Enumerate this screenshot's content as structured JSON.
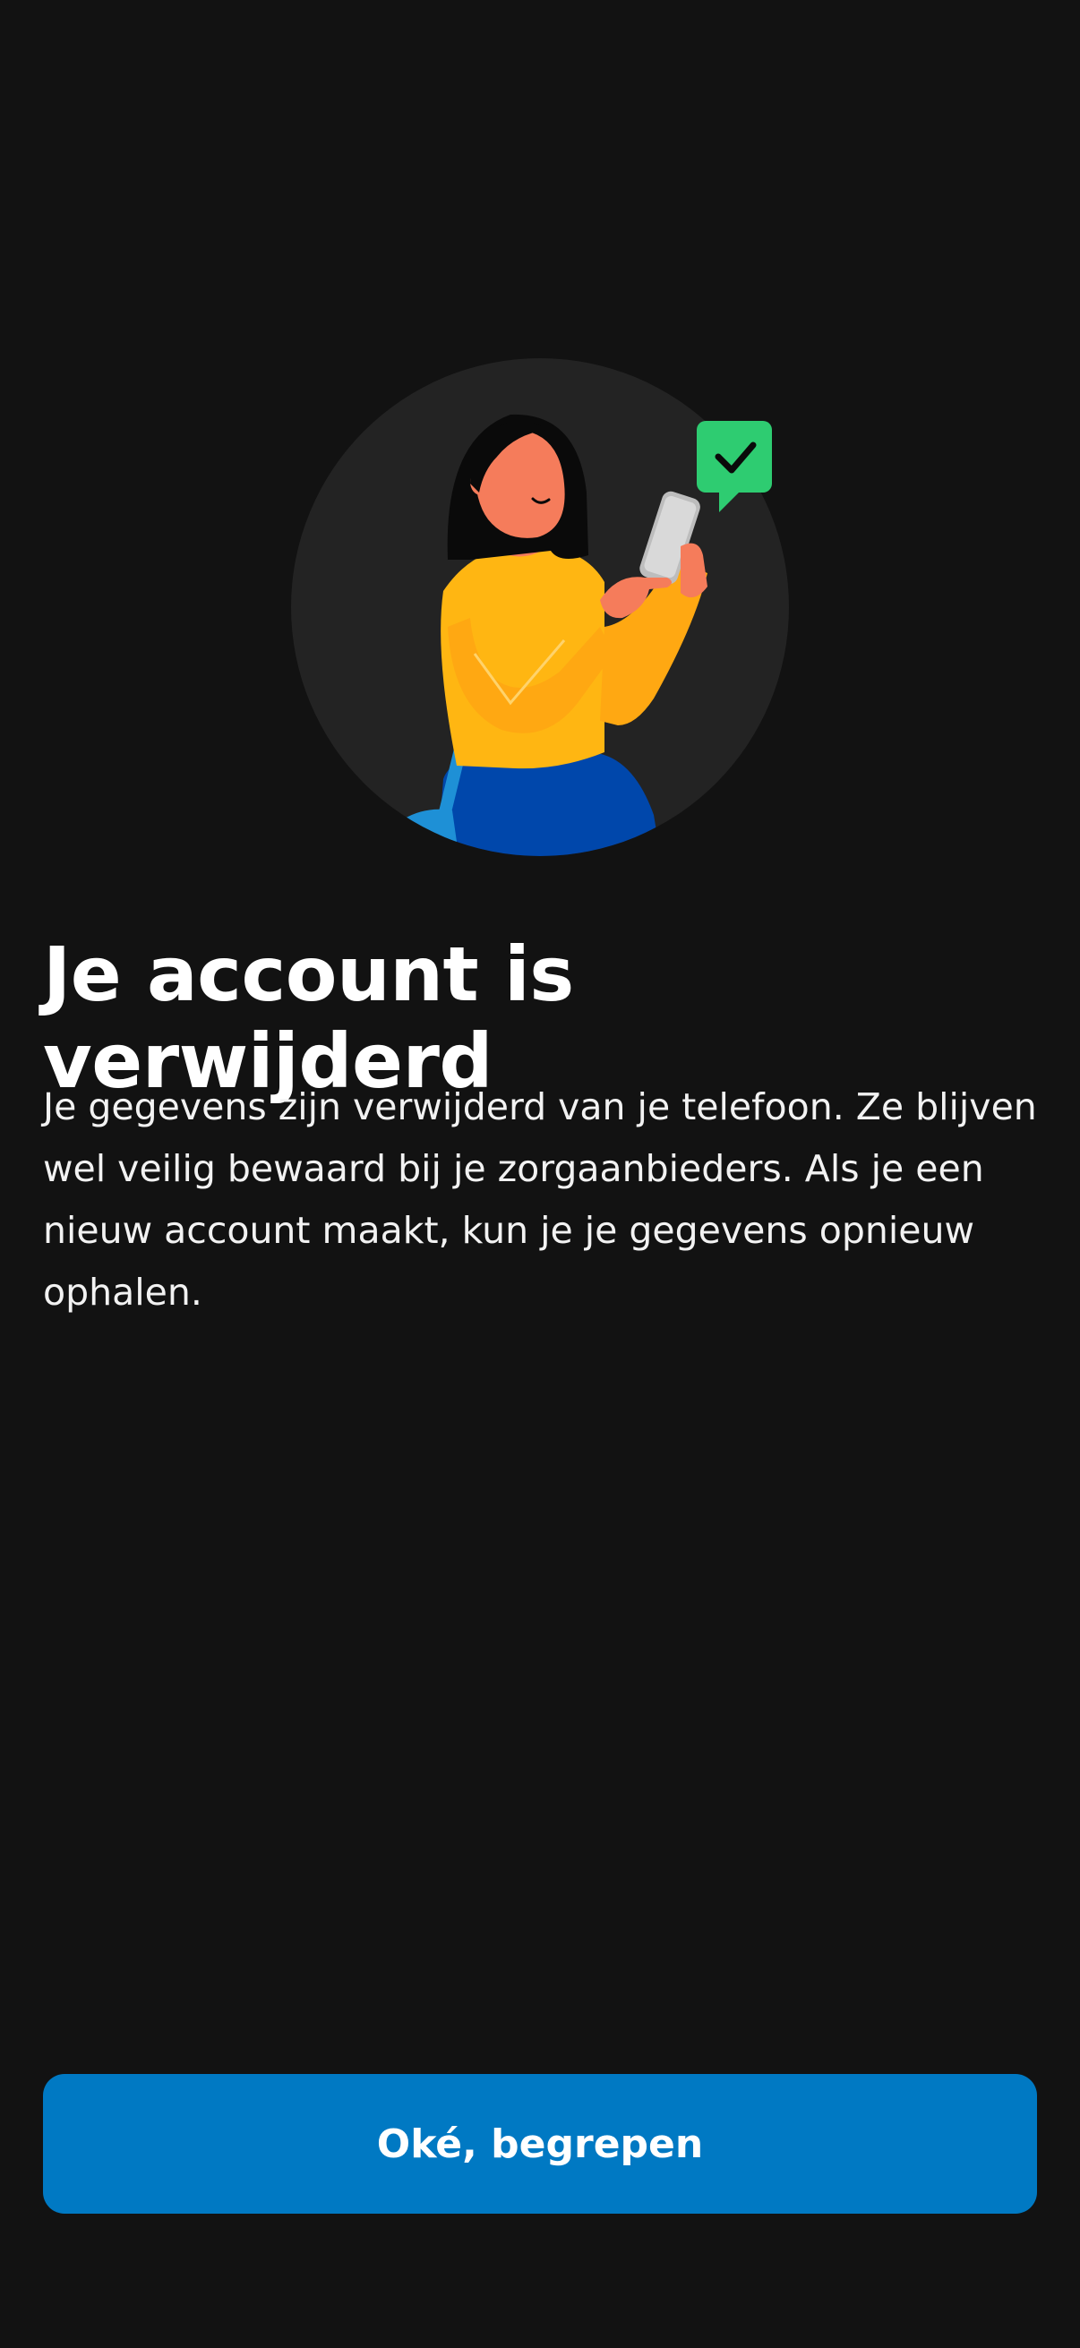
{
  "screen": {
    "illustration": {
      "icon": "person-with-phone-checkmark-illustration",
      "badge_icon": "checkmark-icon",
      "colors": {
        "circle": "#232323",
        "badge": "#2ecc71",
        "sweater": "#ffb612",
        "skin": "#f57c5b",
        "hair": "#0a0a0a",
        "pants": "#0047ab",
        "bag_strap": "#1e90d6"
      }
    },
    "title": "Je account is verwijderd",
    "body": "Je gegevens zijn verwijderd van je telefoon. Ze blijven wel veilig bewaard bij je zorgaanbieders. Als je een nieuw account maakt, kun je je gegevens opnieuw ophalen.",
    "primary_button": {
      "label": "Oké, begrepen",
      "color": "#0079c3"
    }
  }
}
